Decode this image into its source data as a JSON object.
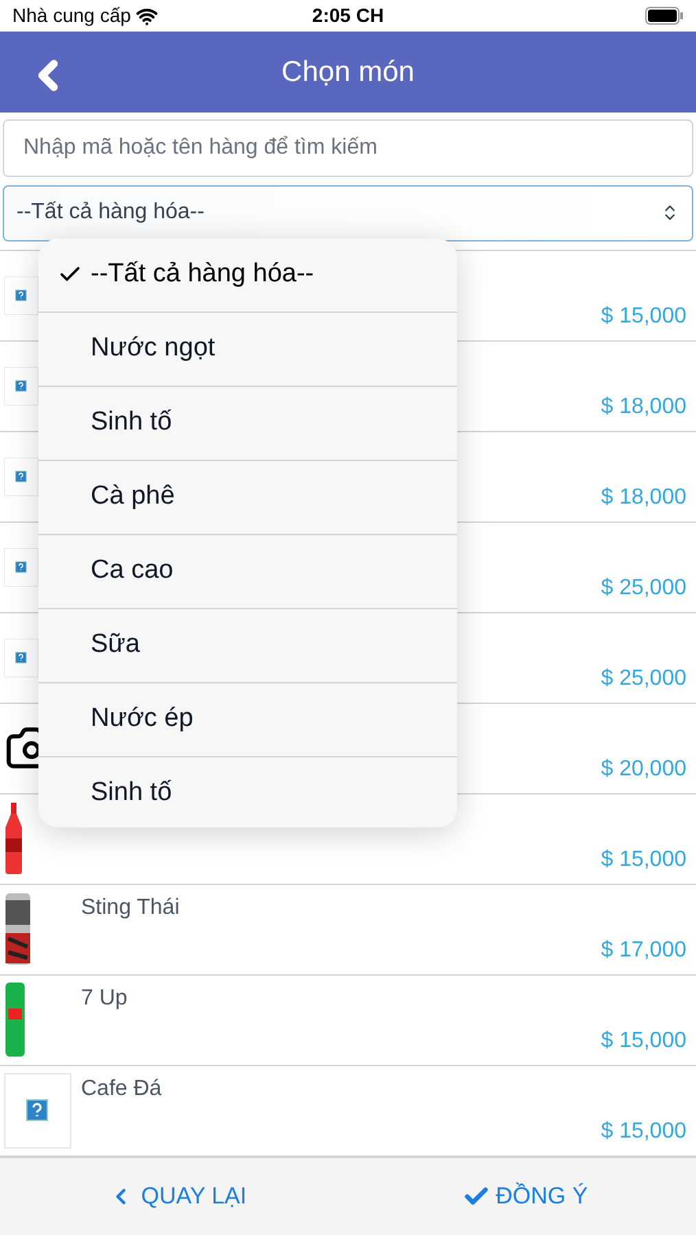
{
  "status_bar": {
    "carrier": "Nhà cung cấp",
    "time": "2:05 CH"
  },
  "header": {
    "title": "Chọn món"
  },
  "search": {
    "placeholder": "Nhập mã hoặc tên hàng để tìm kiếm"
  },
  "category_select": {
    "value": "--Tất cả hàng hóa--"
  },
  "products": [
    {
      "kind": "placeholder",
      "price": "$ 15,000"
    },
    {
      "kind": "placeholder",
      "price": "$ 18,000"
    },
    {
      "kind": "placeholder",
      "price": "$ 18,000"
    },
    {
      "kind": "placeholder",
      "price": "$ 25,000"
    },
    {
      "kind": "placeholder",
      "price": "$ 25,000"
    },
    {
      "kind": "camera",
      "price": "$ 20,000"
    },
    {
      "kind": "bottle",
      "price": "$ 15,000"
    },
    {
      "kind": "can",
      "name": "Sting Thái",
      "price": "$ 17,000"
    },
    {
      "kind": "greencan",
      "name": "7 Up",
      "price": "$ 15,000"
    },
    {
      "kind": "placeholder",
      "name": "Cafe Đá",
      "price": "$ 15,000"
    }
  ],
  "dropdown_options": [
    {
      "label": "--Tất cả hàng hóa--",
      "selected": true
    },
    {
      "label": "Nước ngọt",
      "selected": false
    },
    {
      "label": "Sinh tố",
      "selected": false
    },
    {
      "label": "Cà phê",
      "selected": false
    },
    {
      "label": "Ca cao",
      "selected": false
    },
    {
      "label": "Sữa",
      "selected": false
    },
    {
      "label": "Nước ép",
      "selected": false
    },
    {
      "label": "Sinh tố",
      "selected": false
    }
  ],
  "footer": {
    "back": "QUAY LẠI",
    "confirm": "ĐỒNG Ý"
  }
}
